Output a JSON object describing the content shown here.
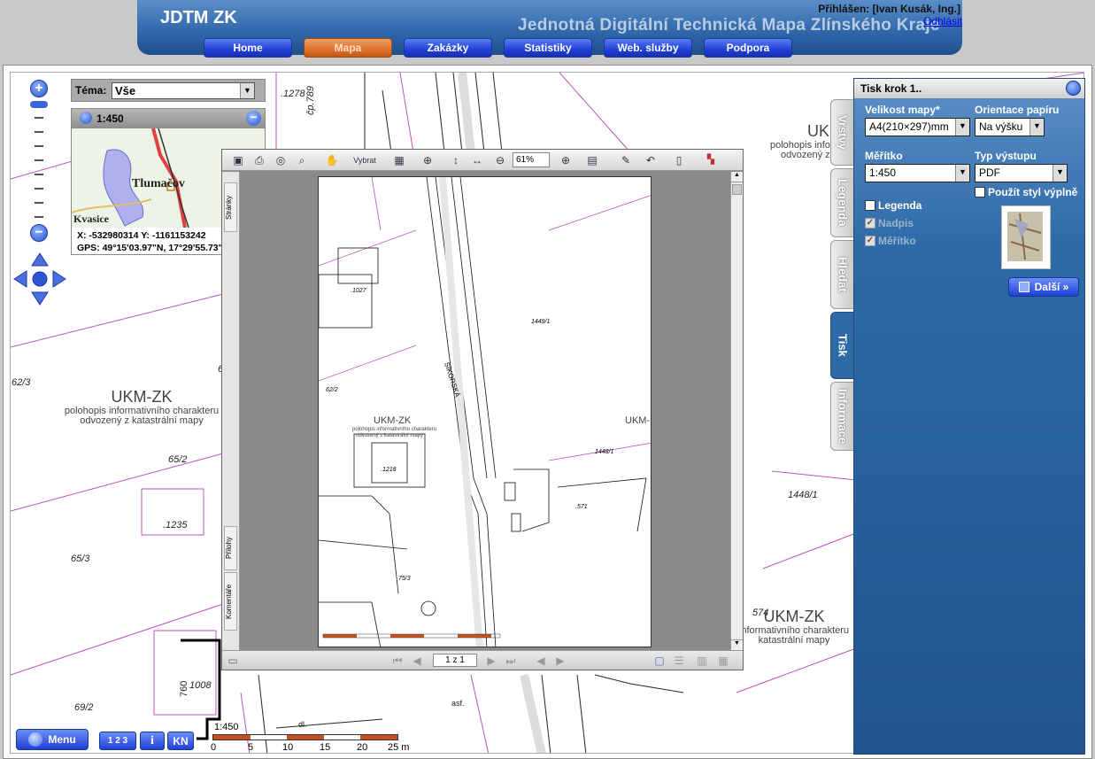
{
  "header": {
    "app_title": "JDTM ZK",
    "app_subtitle": "Jednotná Digitální Technická Mapa Zlínského Kraje",
    "login_text": "Přihlášen: [Ivan Kusák, Ing.]",
    "logout_label": "Odhlásit",
    "nav": [
      {
        "label": "Home",
        "active": false
      },
      {
        "label": "Mapa",
        "active": true
      },
      {
        "label": "Zakázky",
        "active": false
      },
      {
        "label": "Statistiky",
        "active": false
      },
      {
        "label": "Web. služby",
        "active": false
      },
      {
        "label": "Podpora",
        "active": false
      }
    ]
  },
  "theme": {
    "label": "Téma:",
    "value": "Vše"
  },
  "overview": {
    "scale": "1:450",
    "town1": "Tlumačov",
    "town2": "Kvasice",
    "coords_xy": "X: -532980314 Y: -1161153242",
    "coords_gps": "GPS: 49°15'03.97\"N, 17°29'55.73\""
  },
  "map_labels": {
    "l1278": ".1278",
    "cp789": "čp.789",
    "l62_3": "62/3",
    "l65_2": "65/2",
    "l1235": ".1235",
    "l65_3": "65/3",
    "l69_2": "69/2",
    "l1008": "1008",
    "l760": "760",
    "l1448_1": "1448/1",
    "l574": "574",
    "l6": "6",
    "asf": "asf.",
    "dl": "dl.",
    "ukm_big": "UKM-ZK",
    "ukm_small1": "polohopis informativního charakteru",
    "ukm_small2": "odvozený z katastrální mapy",
    "ukm_right_big": "UKM-ZK",
    "ukm_right_small1": "informativního charakteru",
    "ukm_right_small2": "katastrální mapy",
    "ukm_top_big": "UKI",
    "ukm_top_small1": "polohopis inform",
    "ukm_top_small2": "odvozený z k"
  },
  "pdf_viewer": {
    "zoom_value": "61%",
    "page_value": "1 z 1",
    "side_tabs": [
      "Stránky",
      "Přílohy",
      "Komentáře"
    ],
    "tool_select_label": "Vybrat",
    "page_labels": {
      "street": "SÍKORSKÁ",
      "l1448": "1448/1",
      "l1449": "1449/1",
      "l571": ".571",
      "l1027": ".1027",
      "l1218": ".1218",
      "l75_3": "75/3",
      "l62_2": "62/2",
      "ukm_big": "UKM-ZK",
      "ukm_small1": "polohopis informativního charakteru",
      "ukm_small2": "odvozený z katastrální mapy",
      "ukm_r": "UKM-"
    }
  },
  "tabs": [
    {
      "label": "Vrstvy",
      "active": false
    },
    {
      "label": "Legenda",
      "active": false
    },
    {
      "label": "Hledat",
      "active": false
    },
    {
      "label": "Tisk",
      "active": true
    },
    {
      "label": "Informace",
      "active": false
    }
  ],
  "print_panel": {
    "title": "Tisk krok 1..",
    "map_size_label": "Velikost mapy*",
    "map_size_value": "A4(210×297)mm",
    "orientation_label": "Orientace papíru",
    "orientation_value": "Na výšku",
    "scale_label": "Měřítko",
    "scale_value": "1:450",
    "output_label": "Typ výstupu",
    "output_value": "PDF",
    "fill_style_label": "Použít styl výplně",
    "legend_label": "Legenda",
    "title_label": "Nadpis",
    "scale_chk_label": "Měřítko",
    "next_label": "Další »"
  },
  "bottom": {
    "menu_label": "Menu",
    "order_label": "1 2 3",
    "info_label": "i",
    "kn_label": "KN",
    "scale_ratio": "1:450",
    "scale_ticks": [
      "0",
      "5",
      "10",
      "15",
      "20",
      "25 m"
    ]
  },
  "colors": {
    "accent": "#2d6aa8",
    "active_tab": "#e0702a",
    "parcel_line": "#c050c0"
  }
}
